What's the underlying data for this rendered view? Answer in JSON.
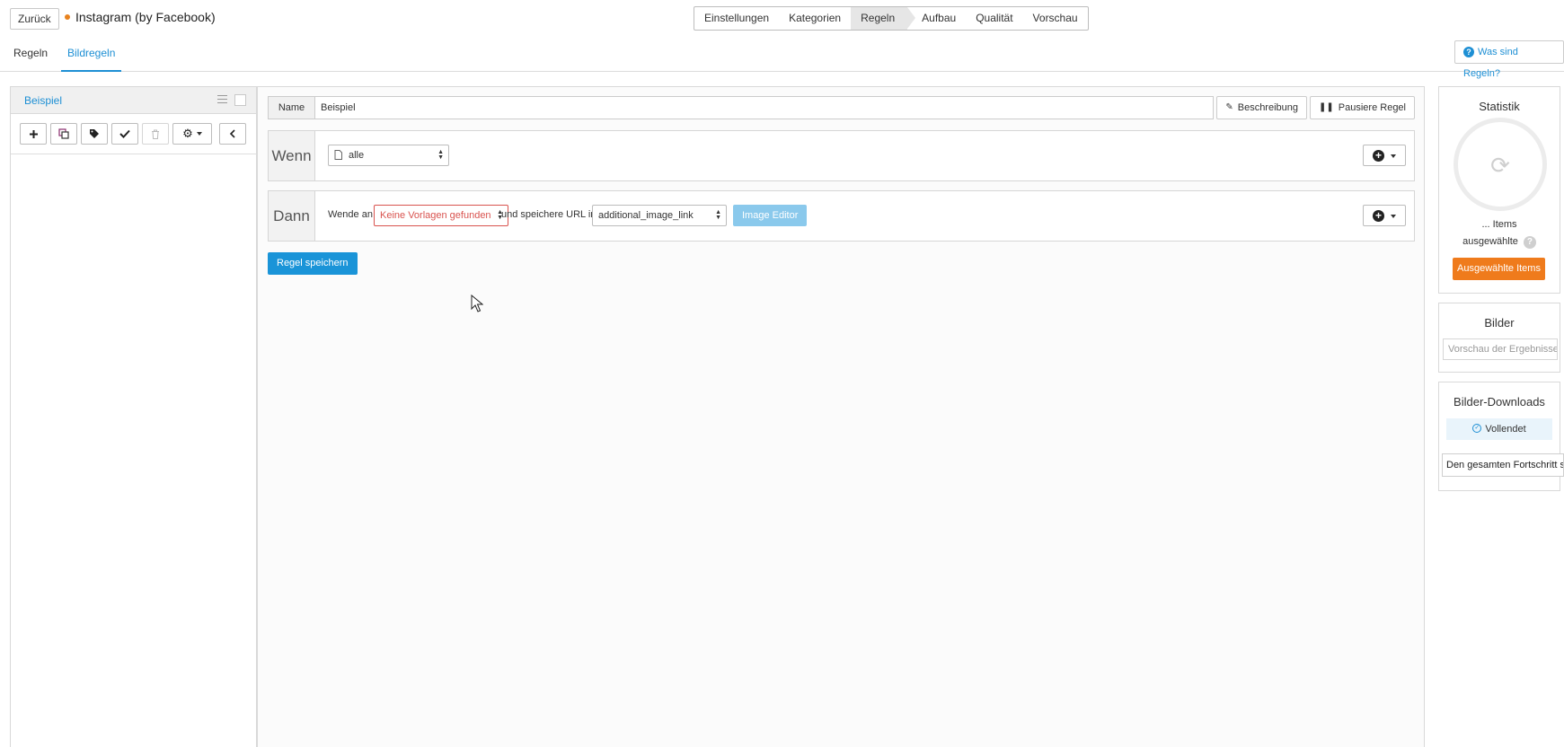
{
  "header": {
    "back_label": "Zurück",
    "app_title": "Instagram (by Facebook)",
    "steps": [
      "Einstellungen",
      "Kategorien",
      "Regeln",
      "Aufbau",
      "Qualität",
      "Vorschau"
    ],
    "active_step": "Regeln"
  },
  "subtabs": {
    "items": [
      "Regeln",
      "Bildregeln"
    ],
    "active": "Bildregeln",
    "help_label": "Was sind Regeln?"
  },
  "left": {
    "rule_name": "Beispiel"
  },
  "rule": {
    "name_label": "Name",
    "name_value": "Beispiel",
    "description_label": "Beschreibung",
    "pause_label": "Pausiere Regel",
    "if_label": "Wenn",
    "if_select": "alle",
    "then_label": "Dann",
    "apply_label": "Wende an",
    "template_select": "Keine Vorlagen gefunden",
    "save_url_label": "und speichere URL in",
    "field_select": "additional_image_link",
    "image_editor_label": "Image Editor",
    "save_rule_label": "Regel speichern"
  },
  "stats": {
    "title": "Statistik",
    "items_label": "... Items",
    "selected_label": "ausgewählte",
    "selected_button": "Ausgewählte Items"
  },
  "images": {
    "title": "Bilder",
    "preview_placeholder": "Vorschau der Ergebnisse"
  },
  "downloads": {
    "title": "Bilder-Downloads",
    "status": "Vollendet",
    "tooltip": "Den gesamten Fortschritt se"
  },
  "colors": {
    "accent": "#1d8fd4",
    "orange": "#ef7b1c",
    "error": "#d9534f"
  }
}
